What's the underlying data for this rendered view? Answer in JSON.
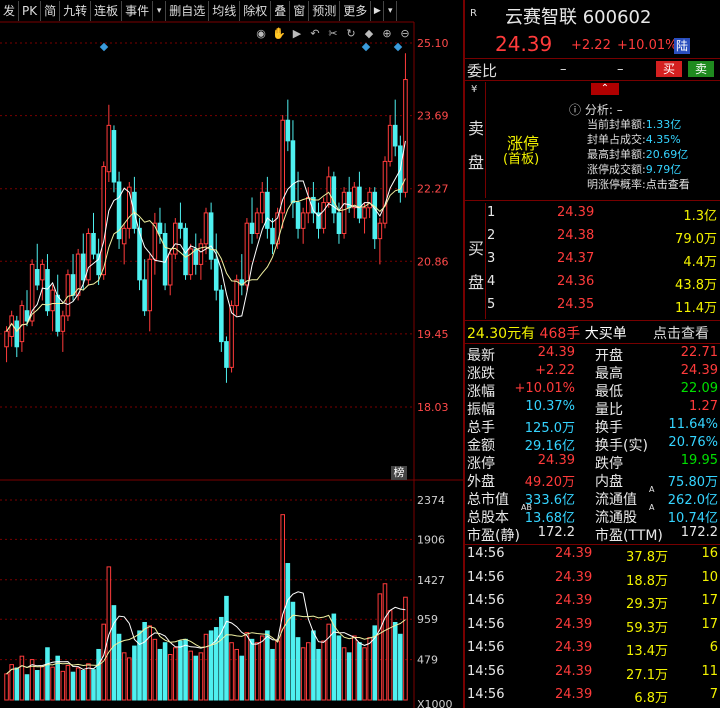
{
  "toolbar": {
    "items": [
      "发",
      "PK",
      "简",
      "九转",
      "连板",
      "事件",
      "▾",
      "删自选",
      "均线",
      "除权",
      "叠",
      "窗",
      "预测",
      "更多",
      "▶",
      "▾"
    ]
  },
  "chart": {
    "price_labels": [
      "25.10",
      "23.69",
      "22.27",
      "20.86",
      "19.45",
      "18.03"
    ],
    "volume_labels": [
      "2374",
      "1906",
      "1427",
      "959",
      "479",
      "X1000"
    ],
    "board_tag": "榜",
    "icons": [
      "eye-icon",
      "hand-icon",
      "play-icon",
      "undo-icon",
      "scissors-icon",
      "refresh-icon",
      "diamond-icon",
      "plus-icon",
      "minus-icon"
    ]
  },
  "chart_data": {
    "type": "bar",
    "title": "",
    "price_ylim": [
      18.03,
      25.1
    ],
    "volume_ylim": [
      0,
      2374
    ],
    "candles": [
      [
        19.2,
        19.6,
        18.9,
        19.5
      ],
      [
        19.4,
        19.9,
        19.2,
        19.8
      ],
      [
        19.7,
        19.8,
        19.0,
        19.2
      ],
      [
        19.3,
        20.1,
        19.1,
        20.0
      ],
      [
        19.9,
        20.3,
        19.6,
        19.7
      ],
      [
        19.7,
        20.9,
        19.6,
        20.8
      ],
      [
        20.7,
        21.2,
        20.3,
        20.4
      ],
      [
        20.5,
        20.9,
        20.1,
        20.8
      ],
      [
        20.7,
        21.0,
        19.8,
        19.9
      ],
      [
        19.9,
        20.4,
        19.5,
        20.3
      ],
      [
        20.2,
        20.6,
        19.4,
        19.5
      ],
      [
        19.5,
        19.9,
        19.1,
        19.8
      ],
      [
        19.8,
        20.7,
        19.7,
        20.6
      ],
      [
        20.6,
        21.0,
        20.1,
        20.2
      ],
      [
        20.2,
        21.1,
        20.1,
        21.0
      ],
      [
        21.0,
        21.4,
        20.3,
        20.5
      ],
      [
        20.5,
        21.5,
        20.4,
        21.4
      ],
      [
        21.4,
        21.8,
        20.9,
        21.0
      ],
      [
        21.0,
        21.3,
        20.4,
        20.6
      ],
      [
        20.6,
        22.8,
        20.5,
        22.7
      ],
      [
        22.6,
        23.9,
        22.4,
        23.5
      ],
      [
        23.4,
        23.5,
        22.2,
        22.4
      ],
      [
        22.4,
        22.6,
        21.1,
        21.3
      ],
      [
        21.2,
        21.6,
        20.8,
        21.5
      ],
      [
        21.5,
        22.4,
        21.3,
        22.3
      ],
      [
        22.2,
        22.5,
        21.4,
        21.5
      ],
      [
        21.5,
        21.7,
        20.3,
        20.5
      ],
      [
        20.5,
        20.9,
        19.8,
        19.9
      ],
      [
        19.9,
        21.0,
        19.5,
        20.9
      ],
      [
        20.9,
        21.8,
        20.6,
        21.6
      ],
      [
        21.6,
        21.9,
        21.2,
        21.4
      ],
      [
        21.4,
        21.6,
        20.3,
        20.4
      ],
      [
        20.4,
        21.1,
        20.2,
        21.0
      ],
      [
        21.0,
        21.7,
        20.9,
        21.6
      ],
      [
        21.6,
        22.0,
        21.3,
        21.5
      ],
      [
        21.5,
        21.6,
        20.5,
        20.6
      ],
      [
        20.6,
        21.2,
        20.5,
        21.1
      ],
      [
        21.1,
        21.4,
        20.6,
        20.8
      ],
      [
        20.8,
        21.3,
        20.5,
        21.2
      ],
      [
        21.2,
        21.9,
        21.0,
        21.8
      ],
      [
        21.8,
        22.0,
        20.7,
        20.9
      ],
      [
        20.9,
        21.4,
        20.1,
        20.3
      ],
      [
        20.3,
        20.4,
        19.1,
        19.3
      ],
      [
        19.3,
        19.4,
        18.5,
        18.8
      ],
      [
        18.8,
        20.1,
        18.7,
        20.0
      ],
      [
        20.0,
        20.6,
        19.8,
        20.5
      ],
      [
        20.5,
        21.0,
        20.2,
        20.4
      ],
      [
        20.4,
        21.7,
        20.3,
        21.6
      ],
      [
        21.6,
        22.1,
        21.2,
        21.4
      ],
      [
        21.4,
        21.9,
        21.3,
        21.8
      ],
      [
        21.8,
        22.4,
        21.6,
        22.2
      ],
      [
        22.2,
        22.5,
        21.3,
        21.5
      ],
      [
        21.5,
        21.7,
        21.0,
        21.2
      ],
      [
        21.2,
        21.9,
        21.1,
        21.8
      ],
      [
        21.8,
        23.7,
        21.5,
        23.6
      ],
      [
        23.6,
        24.0,
        23.0,
        23.2
      ],
      [
        23.2,
        23.6,
        21.7,
        22.0
      ],
      [
        22.0,
        22.6,
        21.3,
        21.5
      ],
      [
        21.5,
        21.9,
        21.2,
        21.8
      ],
      [
        21.8,
        22.3,
        21.6,
        22.1
      ],
      [
        22.1,
        22.4,
        21.6,
        21.8
      ],
      [
        21.8,
        22.0,
        21.3,
        21.5
      ],
      [
        21.5,
        22.1,
        21.4,
        22.0
      ],
      [
        22.0,
        22.7,
        21.9,
        22.5
      ],
      [
        22.5,
        22.6,
        21.6,
        21.8
      ],
      [
        21.8,
        22.0,
        21.2,
        21.4
      ],
      [
        21.4,
        22.3,
        21.3,
        22.2
      ],
      [
        22.2,
        22.5,
        21.8,
        21.9
      ],
      [
        21.9,
        22.4,
        21.7,
        22.3
      ],
      [
        22.3,
        22.6,
        21.6,
        21.7
      ],
      [
        21.7,
        22.0,
        21.4,
        21.9
      ],
      [
        21.9,
        22.3,
        21.7,
        22.2
      ],
      [
        22.2,
        22.3,
        21.1,
        21.3
      ],
      [
        21.3,
        21.7,
        20.8,
        21.6
      ],
      [
        21.6,
        22.9,
        21.5,
        22.8
      ],
      [
        22.8,
        23.7,
        22.7,
        23.5
      ],
      [
        23.5,
        24.0,
        22.9,
        23.1
      ],
      [
        23.1,
        23.3,
        22.0,
        22.2
      ],
      [
        22.2,
        24.9,
        22.1,
        24.39
      ]
    ],
    "volumes": [
      310,
      420,
      380,
      520,
      300,
      480,
      350,
      400,
      620,
      390,
      520,
      340,
      410,
      330,
      380,
      350,
      430,
      360,
      600,
      900,
      1580,
      1120,
      780,
      560,
      500,
      640,
      820,
      920,
      880,
      720,
      600,
      680,
      540,
      620,
      700,
      720,
      580,
      520,
      560,
      780,
      820,
      860,
      980,
      1230,
      680,
      600,
      520,
      800,
      720,
      680,
      760,
      820,
      600,
      700,
      2200,
      1620,
      1160,
      740,
      620,
      680,
      820,
      600,
      700,
      900,
      1020,
      760,
      620,
      560,
      760,
      680,
      620,
      740,
      880,
      1260,
      1380,
      1060,
      920,
      780,
      1220
    ],
    "ma_price": "series drawn as yellow and white moving average lines",
    "ma_volume": "series drawn as yellow and white moving average lines"
  },
  "header": {
    "r_mark": "R",
    "name": "云赛智联",
    "code": "600602",
    "price": "24.39",
    "change": "+2.22",
    "pct": "+10.01%",
    "tag": "陆"
  },
  "weibi": {
    "label": "委比",
    "v1": "–",
    "v2": "–",
    "buy": "买",
    "sell": "卖"
  },
  "sell_panel": {
    "label": [
      "卖",
      "盘"
    ],
    "limit_up": "涨停",
    "first_board": "(首板)",
    "analysis_label": "分析:",
    "analysis_value": "–",
    "rows": [
      {
        "k": "当前封单额:",
        "v": "1.33亿"
      },
      {
        "k": "封单占成交:",
        "v": "4.35%"
      },
      {
        "k": "最高封单额:",
        "v": "20.69亿"
      },
      {
        "k": "涨停成交额:",
        "v": "9.79亿"
      },
      {
        "k": "明涨停概率:",
        "v": "点击查看"
      }
    ]
  },
  "buy_panel": {
    "label": [
      "买",
      "盘"
    ],
    "rows": [
      {
        "n": "1",
        "p": "24.39",
        "v": "1.3亿"
      },
      {
        "n": "2",
        "p": "24.38",
        "v": "79.0万"
      },
      {
        "n": "3",
        "p": "24.37",
        "v": "4.4万"
      },
      {
        "n": "4",
        "p": "24.36",
        "v": "43.8万"
      },
      {
        "n": "5",
        "p": "24.35",
        "v": "11.4万"
      }
    ]
  },
  "bigorder": {
    "price": "24.30元有",
    "qty": "468手",
    "label": "大买单",
    "link": "点击查看"
  },
  "quote": {
    "rows": [
      [
        "最新",
        "24.39",
        "开盘",
        "22.71"
      ],
      [
        "涨跌",
        "+2.22",
        "最高",
        "24.39"
      ],
      [
        "涨幅",
        "+10.01%",
        "最低",
        "22.09"
      ],
      [
        "振幅",
        "10.37%",
        "量比",
        "1.27"
      ],
      [
        "总手",
        "125.0万",
        "换手",
        "11.64%"
      ],
      [
        "金额",
        "29.16亿",
        "换手(实)",
        "20.76%"
      ],
      [
        "涨停",
        "24.39",
        "跌停",
        "19.95"
      ],
      [
        "外盘",
        "49.20万",
        "内盘",
        "75.80万"
      ],
      [
        "总市值",
        "333.6亿",
        "流通值",
        "262.0亿"
      ],
      [
        "总股本",
        "13.68亿",
        "流通股",
        "10.74亿"
      ],
      [
        "市盈(静)",
        "172.2",
        "市盈(TTM)",
        "172.2"
      ]
    ],
    "sup_a": "A",
    "sup_ab": "AB"
  },
  "ticks": {
    "rows": [
      [
        "14:56",
        "24.39",
        "37.8万",
        "16"
      ],
      [
        "14:56",
        "24.39",
        "18.8万",
        "10"
      ],
      [
        "14:56",
        "24.39",
        "29.3万",
        "17"
      ],
      [
        "14:56",
        "24.39",
        "59.3万",
        "17"
      ],
      [
        "14:56",
        "24.39",
        "13.4万",
        "6"
      ],
      [
        "14:56",
        "24.39",
        "27.1万",
        "11"
      ],
      [
        "14:56",
        "24.39",
        "6.8万",
        "7"
      ]
    ]
  },
  "colors": {
    "up": "#ff3b3b",
    "down": "#4ff0f0",
    "ma1": "#f0f0a0",
    "ma2": "#ffffff",
    "grid": "#7a0000"
  }
}
